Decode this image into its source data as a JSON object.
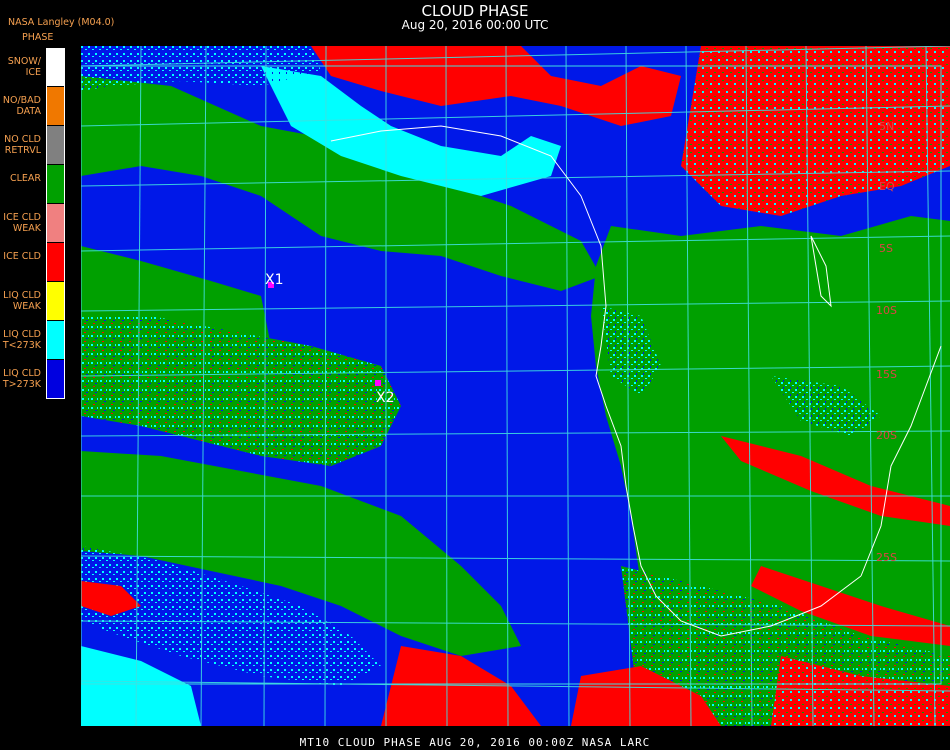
{
  "header": {
    "title": "CLOUD PHASE",
    "subtitle": "Aug 20, 2016 00:00 UTC",
    "credit": "NASA Langley (M04.0)",
    "legend_title": "PHASE"
  },
  "legend": [
    {
      "label": "SNOW/\nICE",
      "color": "#ffffff"
    },
    {
      "label": "NO/BAD\nDATA",
      "color": "#f07800"
    },
    {
      "label": "NO CLD\nRETRVL",
      "color": "#808080"
    },
    {
      "label": "CLEAR",
      "color": "#00a000"
    },
    {
      "label": "ICE CLD\nWEAK",
      "color": "#f08080"
    },
    {
      "label": "ICE CLD",
      "color": "#ff0000"
    },
    {
      "label": "LIQ CLD\nWEAK",
      "color": "#ffff00"
    },
    {
      "label": "LIQ CLD\nT<273K",
      "color": "#00ffff"
    },
    {
      "label": "LIQ CLD\nT>273K",
      "color": "#0000e0"
    }
  ],
  "map": {
    "markers": [
      {
        "label": "X1"
      },
      {
        "label": "X2"
      }
    ],
    "lat_labels": [
      "5N",
      "EQ",
      "5S",
      "10S",
      "15S",
      "20S",
      "25S"
    ],
    "colors": {
      "liquid_warm": "#0018e8",
      "liquid_cold": "#00ffff",
      "clear": "#00a000",
      "ice": "#ff0000",
      "grid": "#40e0e0",
      "coast": "#ffffff",
      "marker": "#ff00ff"
    }
  },
  "footer": {
    "text": "MT10  CLOUD PHASE   AUG 20, 2016 00:00Z   NASA LARC"
  }
}
